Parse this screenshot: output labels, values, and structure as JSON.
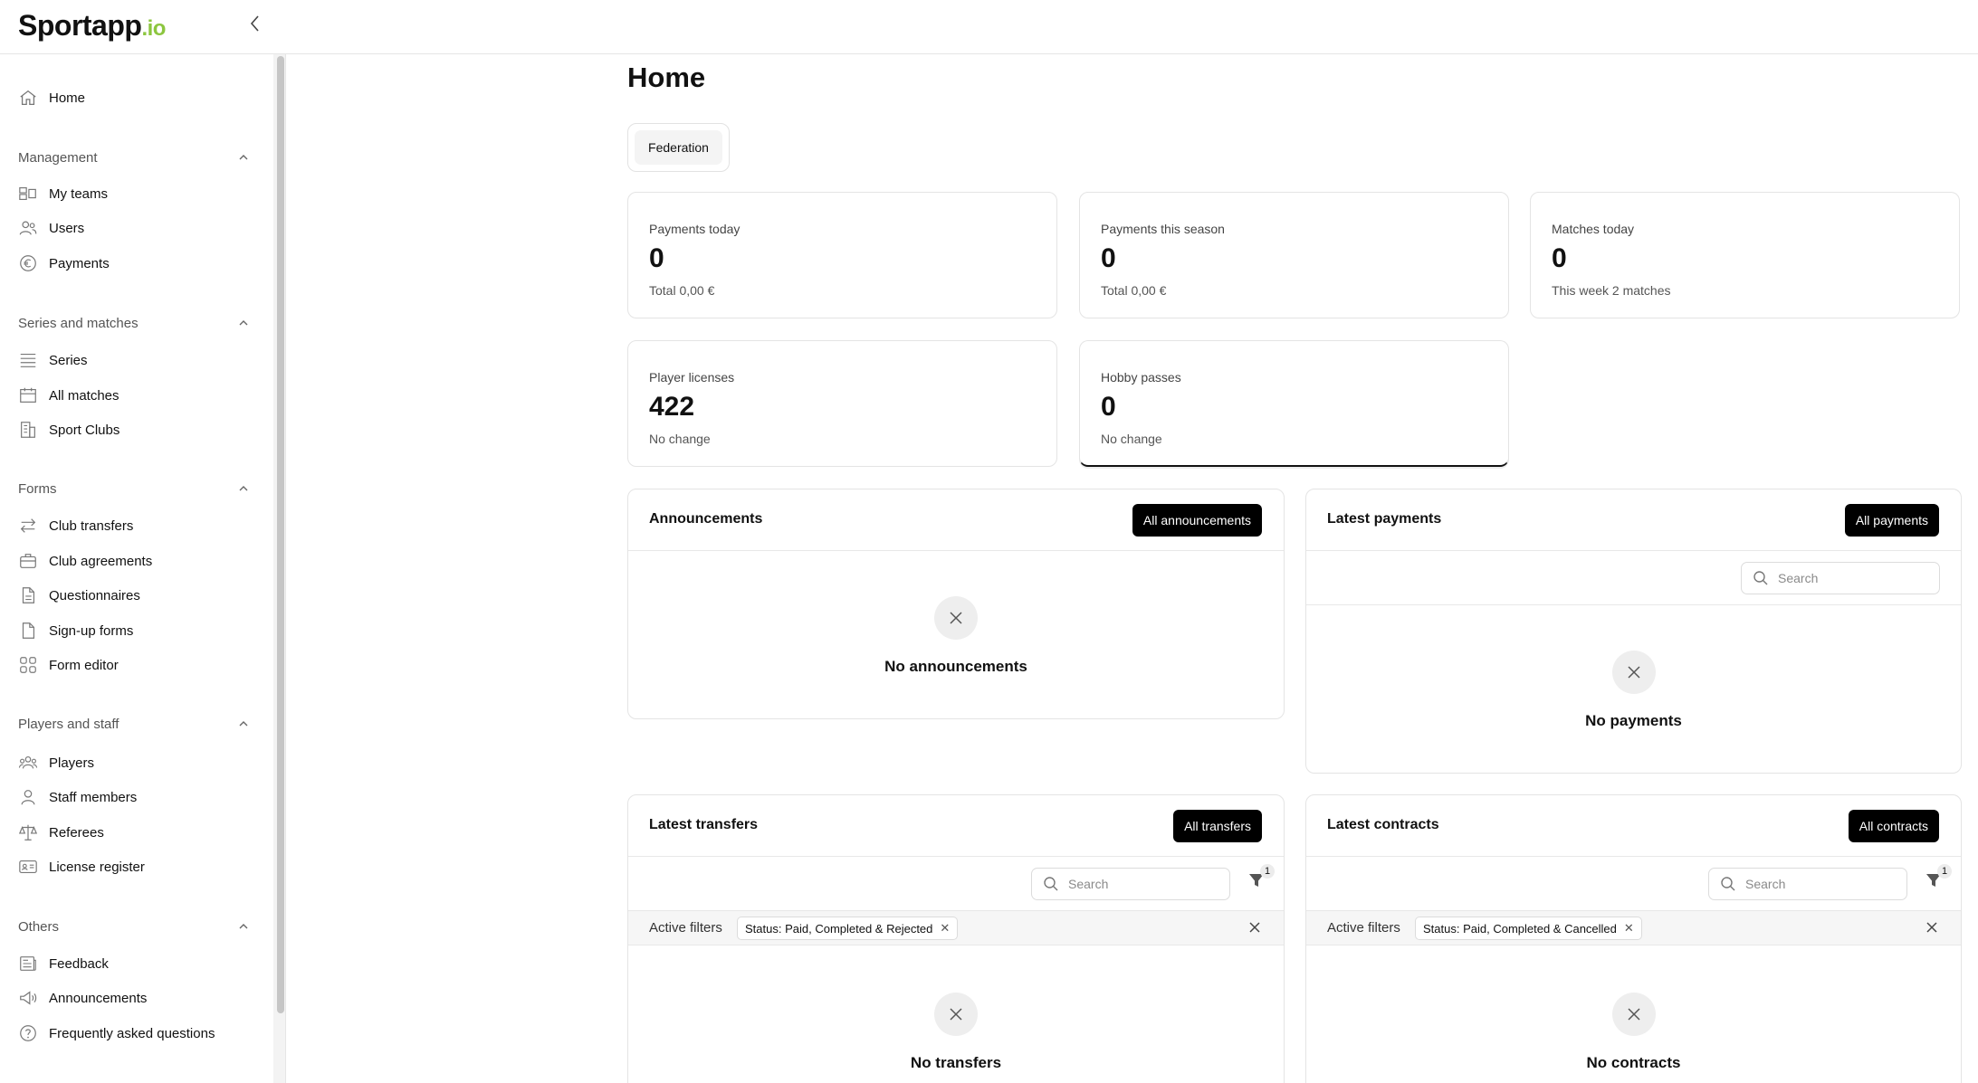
{
  "brand": {
    "name": "Sportapp",
    "suffix": ".io"
  },
  "sidebar": {
    "home": "Home",
    "sections": [
      {
        "title": "Management",
        "items": [
          "My teams",
          "Users",
          "Payments"
        ]
      },
      {
        "title": "Series and matches",
        "items": [
          "Series",
          "All matches",
          "Sport Clubs"
        ]
      },
      {
        "title": "Forms",
        "items": [
          "Club transfers",
          "Club agreements",
          "Questionnaires",
          "Sign-up forms",
          "Form editor"
        ]
      },
      {
        "title": "Players and staff",
        "items": [
          "Players",
          "Staff members",
          "Referees",
          "License register"
        ]
      },
      {
        "title": "Others",
        "items": [
          "Feedback",
          "Announcements",
          "Frequently asked questions"
        ]
      }
    ]
  },
  "main": {
    "title": "Home",
    "tabs": [
      "Federation"
    ],
    "stats": [
      {
        "label": "Payments today",
        "value": "0",
        "sub": "Total 0,00 €"
      },
      {
        "label": "Payments this season",
        "value": "0",
        "sub": "Total 0,00 €"
      },
      {
        "label": "Matches today",
        "value": "0",
        "sub": "This week 2 matches"
      },
      {
        "label": "Player licenses",
        "value": "422",
        "sub": "No change"
      },
      {
        "label": "Hobby passes",
        "value": "0",
        "sub": "No change"
      }
    ],
    "announcements": {
      "title": "Announcements",
      "button": "All announcements",
      "empty": "No announcements"
    },
    "payments": {
      "title": "Latest payments",
      "button": "All payments",
      "search_placeholder": "Search",
      "empty": "No payments"
    },
    "transfers": {
      "title": "Latest transfers",
      "button": "All transfers",
      "search_placeholder": "Search",
      "filter_count": "1",
      "active_filters_label": "Active filters",
      "filter_chip": "Status: Paid, Completed & Rejected",
      "empty": "No transfers"
    },
    "contracts": {
      "title": "Latest contracts",
      "button": "All contracts",
      "search_placeholder": "Search",
      "filter_count": "1",
      "active_filters_label": "Active filters",
      "filter_chip": "Status: Paid, Completed & Cancelled",
      "empty": "No contracts"
    }
  },
  "icons": {
    "close": "close-icon",
    "search": "search-icon",
    "filter": "filter-icon",
    "chevron_up": "chevron-up-icon",
    "collapse": "chevron-left-icon"
  }
}
